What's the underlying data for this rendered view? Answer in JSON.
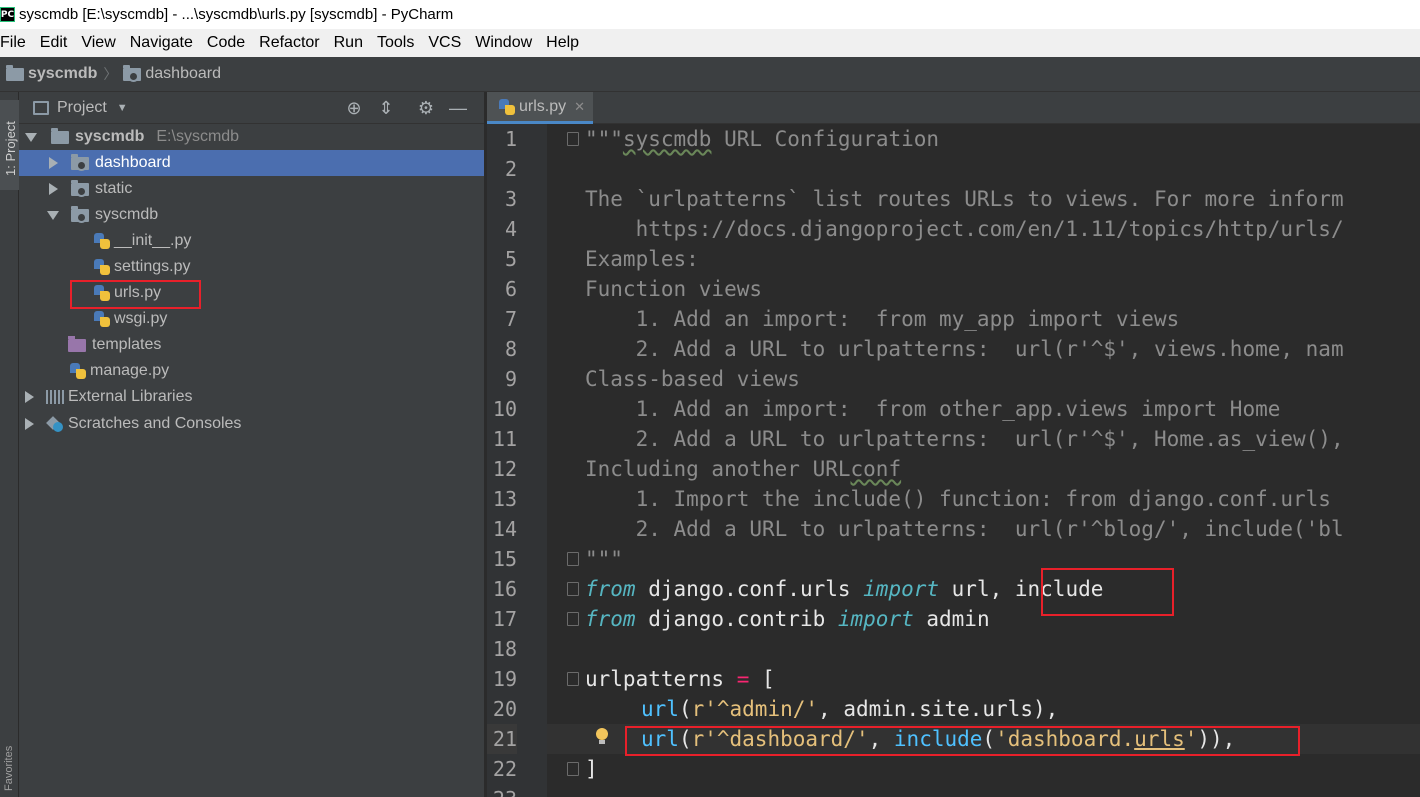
{
  "window": {
    "title": "syscmdb [E:\\syscmdb] - ...\\syscmdb\\urls.py [syscmdb] - PyCharm",
    "icon_text": "PC"
  },
  "menu": [
    "File",
    "Edit",
    "View",
    "Navigate",
    "Code",
    "Refactor",
    "Run",
    "Tools",
    "VCS",
    "Window",
    "Help"
  ],
  "breadcrumb": {
    "root": "syscmdb",
    "child": "dashboard"
  },
  "tool_stripe": {
    "project_tab": "1: Project",
    "favorites_tab": "Favorites"
  },
  "project_panel": {
    "title": "Project",
    "tree": [
      {
        "label": "syscmdb",
        "hint": "E:\\syscmdb",
        "icon": "folder-icon"
      },
      {
        "label": "dashboard",
        "icon": "folder-icon",
        "selected": true
      },
      {
        "label": "static",
        "icon": "folder-icon"
      },
      {
        "label": "syscmdb",
        "icon": "folder-icon"
      },
      {
        "label": "__init__.py",
        "icon": "python-file-icon"
      },
      {
        "label": "settings.py",
        "icon": "python-file-icon"
      },
      {
        "label": "urls.py",
        "icon": "python-file-icon",
        "highlighted": true
      },
      {
        "label": "wsgi.py",
        "icon": "python-file-icon"
      },
      {
        "label": "templates",
        "icon": "template-folder-icon"
      },
      {
        "label": "manage.py",
        "icon": "python-file-icon"
      },
      {
        "label": "External Libraries",
        "icon": "library-icon"
      },
      {
        "label": "Scratches and Consoles",
        "icon": "scratches-icon"
      }
    ]
  },
  "editor": {
    "tab": "urls.py",
    "current_line": 21,
    "line_numbers": [
      "1",
      "2",
      "3",
      "4",
      "5",
      "6",
      "7",
      "8",
      "9",
      "10",
      "11",
      "12",
      "13",
      "14",
      "15",
      "16",
      "17",
      "18",
      "19",
      "20",
      "21",
      "22",
      "23"
    ],
    "lines": {
      "l1a": "\"\"\"",
      "l1b": "syscmdb",
      "l1c": " URL Configuration",
      "l3": "The `urlpatterns` list routes URLs to views. For more inform",
      "l4": "    https://docs.djangoproject.com/en/1.11/topics/http/urls/",
      "l5": "Examples:",
      "l6": "Function views",
      "l7": "    1. Add an import:  from my_app import views",
      "l8": "    2. Add a URL to urlpatterns:  url(r'^$', views.home, nam",
      "l9": "Class-based views",
      "l10": "    1. Add an import:  from other_app.views import Home",
      "l11": "    2. Add a URL to urlpatterns:  url(r'^$', Home.as_view(),",
      "l12a": "Including another URL",
      "l12b": "conf",
      "l13": "    1. Import the include() function: from django.conf.urls",
      "l14": "    2. Add a URL to urlpatterns:  url(r'^blog/', include('bl",
      "l15": "\"\"\"",
      "l16_from": "from",
      "l16_mod": " django.conf.urls ",
      "l16_import": "import",
      "l16_names": " url, include",
      "l17_from": "from",
      "l17_mod": " django.contrib ",
      "l17_import": "import",
      "l17_names": " admin",
      "l19_name": "urlpatterns ",
      "l19_eq": "=",
      "l19_br": " [",
      "l20_fn": "url",
      "l20_p1": "(",
      "l20_str": "r'^admin/'",
      "l20_rest": ", admin.site.urls),",
      "l21_fn": "url",
      "l21_p1": "(",
      "l21_str": "r'^dashboard/'",
      "l21_c": ", ",
      "l21_inc": "include",
      "l21_p2": "(",
      "l21_s1": "'dashboard.",
      "l21_s2": "urls",
      "l21_s3": "'",
      "l21_end": ")),",
      "l22": "]"
    }
  },
  "colors": {
    "selection": "#4b6eaf",
    "annotation_box": "#e8202a",
    "editor_bg": "#2b2b2b"
  }
}
